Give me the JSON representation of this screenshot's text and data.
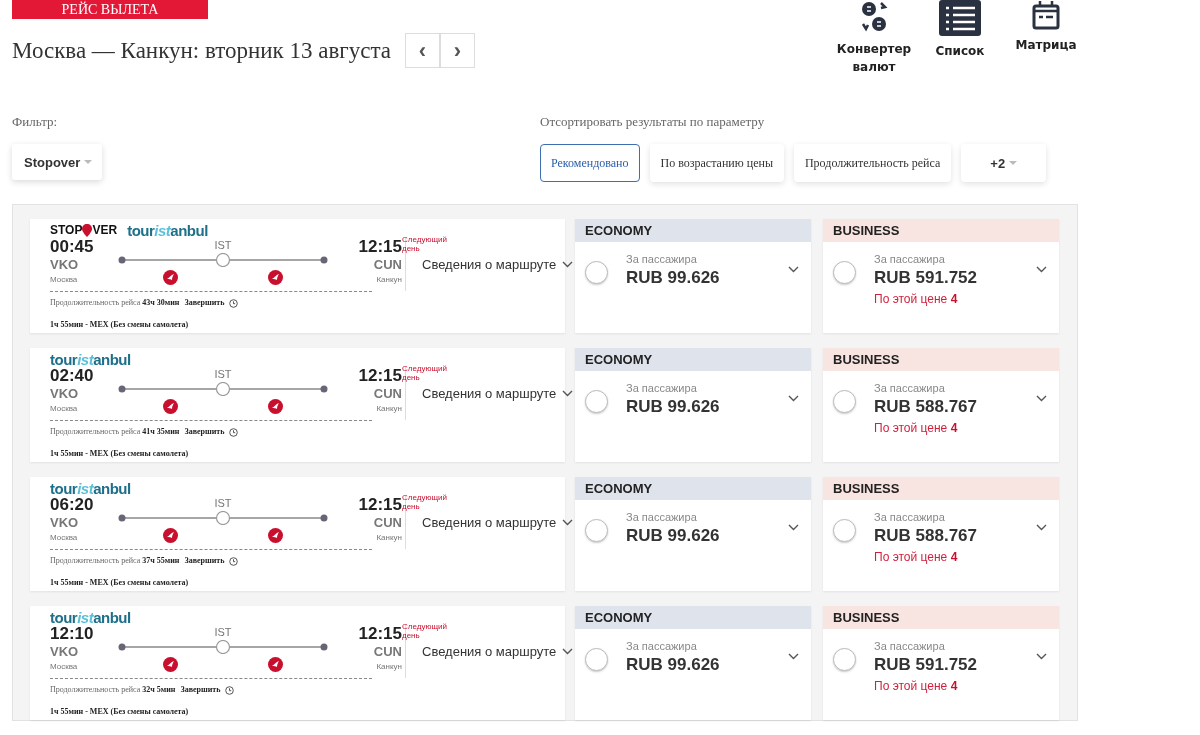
{
  "banner": "РЕЙС ВЫЛЕТА",
  "heading": "Москва — Канкун: вторник 13 августа",
  "date_nav": [
    "‹",
    "›"
  ],
  "views": [
    {
      "kind": "converter",
      "label": "Конвертер валют"
    },
    {
      "kind": "list",
      "label": "Список"
    },
    {
      "kind": "matrix",
      "label": "Матрица"
    }
  ],
  "filter": {
    "label": "Фильтр:",
    "button": "Stopover"
  },
  "sort": {
    "label": "Отсортировать результаты по параметру",
    "options": [
      {
        "label": "Рекомендовано",
        "selected": true
      },
      {
        "label": "По возрастанию цены",
        "selected": false
      },
      {
        "label": "Продолжительность рейса",
        "selected": false
      },
      {
        "label": "+2",
        "selected": false
      }
    ]
  },
  "flights": [
    {
      "stopover": [
        "STOP",
        "VER"
      ],
      "logo": [
        "tour",
        "ist",
        "anbul"
      ],
      "depart_time": "00:45",
      "depart_code": "VKO",
      "depart_city": "Москва",
      "via": "IST",
      "arrive_time": "12:15",
      "next_day": "Следующий день",
      "arrive_code": "CUN",
      "arrive_city": "Канкун",
      "details": "Сведения о маршруте",
      "duration": "Продолжительность рейса **43ч 30мин**",
      "stop_label": "Завершить",
      "stop_info": "1ч 55мин - MEX (Без смены самолета)",
      "fares": [
        {
          "kind": "economy",
          "class": "ECONOMY",
          "per": "За пассажира",
          "price": "RUB 99.626",
          "selected": false
        },
        {
          "kind": "business",
          "class": "BUSINESS",
          "per": "За пассажира",
          "price": "RUB 591.752",
          "note": "По этой цене **4**",
          "selected": false
        }
      ]
    },
    {
      "logo": [
        "tour",
        "ist",
        "anbul"
      ],
      "depart_time": "02:40",
      "depart_code": "VKO",
      "depart_city": "Москва",
      "via": "IST",
      "arrive_time": "12:15",
      "next_day": "Следующий день",
      "arrive_code": "CUN",
      "arrive_city": "Канкун",
      "details": "Сведения о маршруте",
      "duration": "Продолжительность рейса **41ч 35мин**",
      "stop_label": "Завершить",
      "stop_info": "1ч 55мин - MEX (Без смены самолета)",
      "fares": [
        {
          "kind": "economy",
          "class": "ECONOMY",
          "per": "За пассажира",
          "price": "RUB 99.626",
          "selected": false
        },
        {
          "kind": "business",
          "class": "BUSINESS",
          "per": "За пассажира",
          "price": "RUB 588.767",
          "note": "По этой цене **4**",
          "selected": false
        }
      ]
    },
    {
      "logo": [
        "tour",
        "ist",
        "anbul"
      ],
      "depart_time": "06:20",
      "depart_code": "VKO",
      "depart_city": "Москва",
      "via": "IST",
      "arrive_time": "12:15",
      "next_day": "Следующий день",
      "arrive_code": "CUN",
      "arrive_city": "Канкун",
      "details": "Сведения о маршруте",
      "duration": "Продолжительность рейса **37ч 55мин**",
      "stop_label": "Завершить",
      "stop_info": "1ч 55мин - MEX (Без смены самолета)",
      "fares": [
        {
          "kind": "economy",
          "class": "ECONOMY",
          "per": "За пассажира",
          "price": "RUB 99.626",
          "selected": false
        },
        {
          "kind": "business",
          "class": "BUSINESS",
          "per": "За пассажира",
          "price": "RUB 588.767",
          "note": "По этой цене **4**",
          "selected": false
        }
      ]
    },
    {
      "logo": [
        "tour",
        "ist",
        "anbul"
      ],
      "depart_time": "12:10",
      "depart_code": "VKO",
      "depart_city": "Москва",
      "via": "IST",
      "arrive_time": "12:15",
      "next_day": "Следующий день",
      "arrive_code": "CUN",
      "arrive_city": "Канкун",
      "details": "Сведения о маршруте",
      "duration": "Продолжительность рейса **32ч 5мин**",
      "stop_label": "Завершить",
      "stop_info": "1ч 55мин - MEX (Без смены самолета)",
      "fares": [
        {
          "kind": "economy",
          "class": "ECONOMY",
          "per": "За пассажира",
          "price": "RUB 99.626",
          "selected": false
        },
        {
          "kind": "business",
          "class": "BUSINESS",
          "per": "За пассажира",
          "price": "RUB 591.752",
          "note": "По этой цене **4**",
          "selected": false
        }
      ]
    }
  ]
}
